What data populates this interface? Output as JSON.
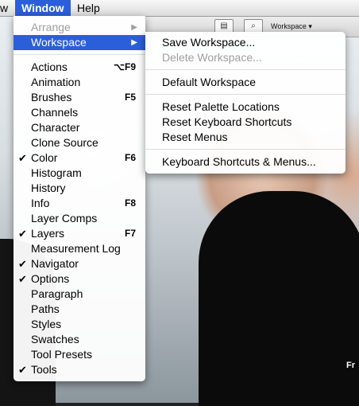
{
  "menubar": {
    "items": [
      "w",
      "Window",
      "Help"
    ]
  },
  "toolbar": {
    "workspace_label": "Workspace ▾"
  },
  "window_menu": {
    "items": [
      {
        "label": "Arrange",
        "disabled": true,
        "submenu": true
      },
      {
        "label": "Workspace",
        "highlighted": true,
        "submenu": true
      },
      {
        "label": "Actions",
        "shortcut": "⌥F9"
      },
      {
        "label": "Animation"
      },
      {
        "label": "Brushes",
        "shortcut": "F5"
      },
      {
        "label": "Channels"
      },
      {
        "label": "Character"
      },
      {
        "label": "Clone Source"
      },
      {
        "label": "Color",
        "checked": true,
        "shortcut": "F6"
      },
      {
        "label": "Histogram"
      },
      {
        "label": "History"
      },
      {
        "label": "Info",
        "shortcut": "F8"
      },
      {
        "label": "Layer Comps"
      },
      {
        "label": "Layers",
        "checked": true,
        "shortcut": "F7"
      },
      {
        "label": "Measurement Log"
      },
      {
        "label": "Navigator",
        "checked": true
      },
      {
        "label": "Options",
        "checked": true
      },
      {
        "label": "Paragraph"
      },
      {
        "label": "Paths"
      },
      {
        "label": "Styles"
      },
      {
        "label": "Swatches"
      },
      {
        "label": "Tool Presets"
      },
      {
        "label": "Tools",
        "checked": true
      }
    ],
    "check_glyph": "✔",
    "arrow_glyph": "▶"
  },
  "workspace_submenu": {
    "items": [
      {
        "label": "Save Workspace..."
      },
      {
        "label": "Delete Workspace...",
        "disabled": true
      },
      {
        "label": "Default Workspace"
      },
      {
        "label": "Reset Palette Locations"
      },
      {
        "label": "Reset Keyboard Shortcuts"
      },
      {
        "label": "Reset Menus"
      },
      {
        "label": "Keyboard Shortcuts & Menus..."
      }
    ]
  },
  "photo": {
    "caption": "Fr"
  },
  "colors": {
    "highlight": "#2b5fd9",
    "disabled_text": "#9e9e9e"
  }
}
